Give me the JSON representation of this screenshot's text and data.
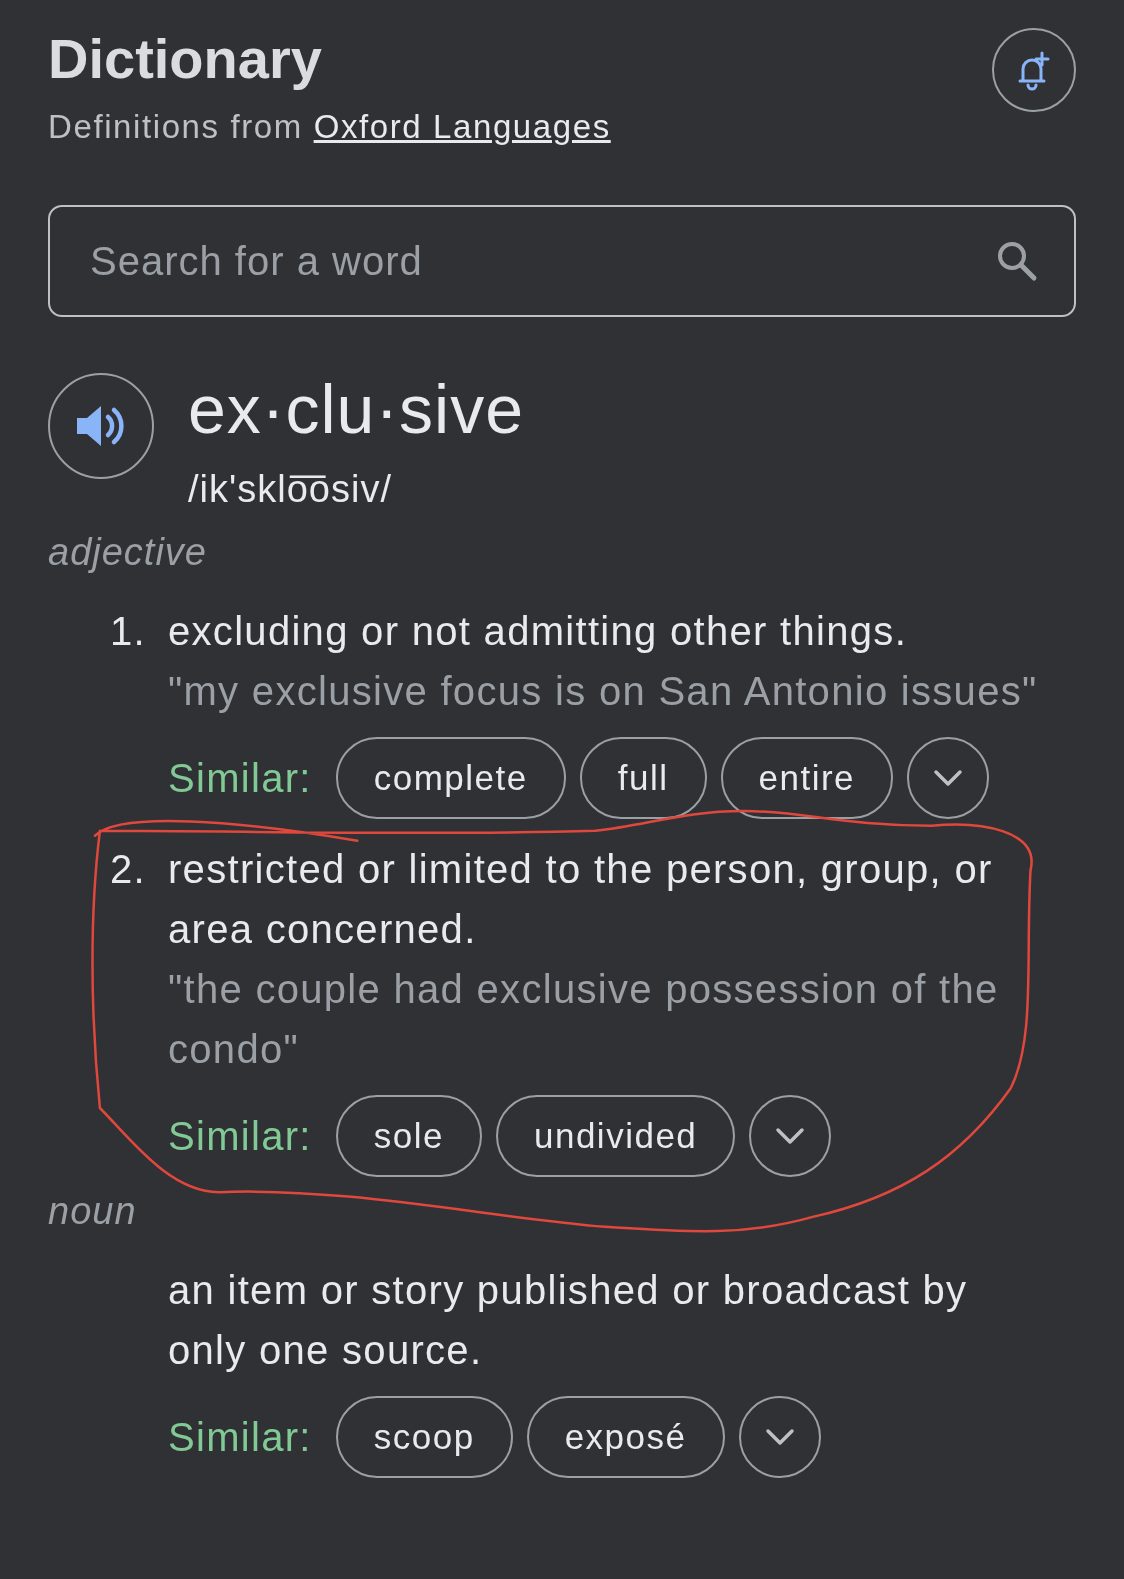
{
  "header": {
    "title": "Dictionary",
    "subtitle_prefix": "Definitions from",
    "source_link": "Oxford Languages"
  },
  "search": {
    "placeholder": "Search for a word"
  },
  "entry": {
    "headword": "ex·clu·sive",
    "pronunciation": "/ik'sklo͞osiv/"
  },
  "senses": [
    {
      "part_of_speech": "adjective",
      "definitions": [
        {
          "number": "1.",
          "text": "excluding or not admitting other things.",
          "example": "\"my exclusive focus is on San Antonio issues\"",
          "similar_label": "Similar:",
          "similar": [
            "complete",
            "full",
            "entire"
          ],
          "circled": false
        },
        {
          "number": "2.",
          "text": "restricted or limited to the person, group, or area concerned.",
          "example": "\"the couple had exclusive possession of the condo\"",
          "similar_label": "Similar:",
          "similar": [
            "sole",
            "undivided"
          ],
          "circled": true
        }
      ]
    },
    {
      "part_of_speech": "noun",
      "definitions": [
        {
          "text": "an item or story published or broadcast by only one source.",
          "similar_label": "Similar:",
          "similar": [
            "scoop",
            "exposé"
          ],
          "circled": false
        }
      ]
    }
  ]
}
